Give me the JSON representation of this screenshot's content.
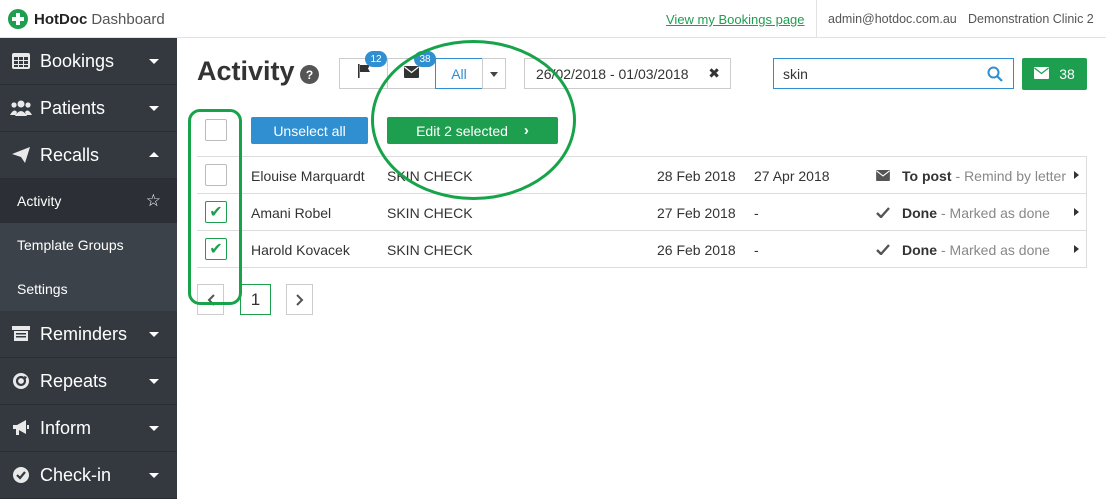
{
  "topbar": {
    "brand": "HotDoc",
    "brand_sub": "Dashboard",
    "bookings_link": "View my Bookings page",
    "user": "admin@hotdoc.com.au",
    "clinic": "Demonstration Clinic 2"
  },
  "sidebar": {
    "items": [
      {
        "label": "Bookings",
        "icon": "table-icon"
      },
      {
        "label": "Patients",
        "icon": "users-icon"
      },
      {
        "label": "Recalls",
        "icon": "send-icon"
      },
      {
        "label": "Reminders",
        "icon": "reminder-icon"
      },
      {
        "label": "Repeats",
        "icon": "repeat-icon"
      },
      {
        "label": "Inform",
        "icon": "megaphone-icon"
      },
      {
        "label": "Check-in",
        "icon": "check-circle-icon"
      }
    ],
    "recalls_sub": [
      {
        "label": "Activity",
        "active": true
      },
      {
        "label": "Template Groups"
      },
      {
        "label": "Settings"
      }
    ]
  },
  "header": {
    "title": "Activity",
    "help": "?",
    "flag_count": "12",
    "mail_count": "38",
    "all_label": "All",
    "date_range": "26/02/2018 - 01/03/2018",
    "date_clear": "✖",
    "search_value": "skin",
    "send_count": "38"
  },
  "actions": {
    "unselect_label": "Unselect all",
    "edit_label": "Edit 2 selected"
  },
  "rows": [
    {
      "name": "Elouise Marquardt",
      "type": "SKIN CHECK",
      "date1": "28 Feb 2018",
      "date2": "27 Apr 2018",
      "status": "To post",
      "detail": "- Remind by letter",
      "checked": false,
      "status_icon": "envelope-icon"
    },
    {
      "name": "Amani Robel",
      "type": "SKIN CHECK",
      "date1": "27 Feb 2018",
      "date2": "-",
      "status": "Done",
      "detail": "- Marked as done",
      "checked": true,
      "status_icon": "check-icon"
    },
    {
      "name": "Harold Kovacek",
      "type": "SKIN CHECK",
      "date1": "26 Feb 2018",
      "date2": "-",
      "status": "Done",
      "detail": "- Marked as done",
      "checked": true,
      "status_icon": "check-icon"
    }
  ],
  "pagination": {
    "current": "1"
  },
  "colors": {
    "green": "#1e9e4f",
    "blue": "#2f8fd0",
    "sidebar": "#34393f"
  }
}
